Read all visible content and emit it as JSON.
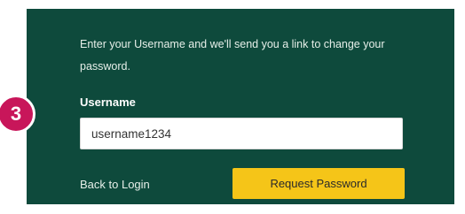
{
  "form": {
    "instructions": "Enter your Username and we'll send you a link to change your password.",
    "username_label": "Username",
    "username_value": "username1234",
    "back_link": "Back to Login",
    "submit_label": "Request Password"
  },
  "annotation": {
    "step_number": "3"
  },
  "colors": {
    "panel_background": "#0e4a3c",
    "button_background": "#f5c518",
    "badge_background": "#c8165a"
  }
}
